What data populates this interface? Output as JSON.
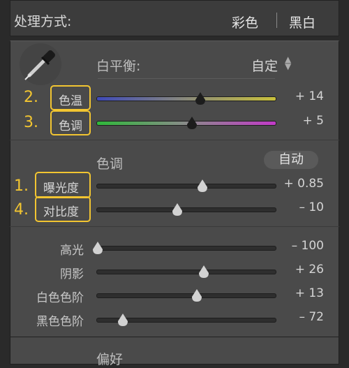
{
  "header": {
    "title": "处理方式:",
    "mode_color": "彩色",
    "mode_bw": "黑白"
  },
  "white_balance": {
    "label": "白平衡:",
    "preset": "自定",
    "temp": {
      "num": "2.",
      "label": "色温",
      "value": "+ 14",
      "level": 0.58
    },
    "tint": {
      "num": "3.",
      "label": "色调",
      "value": "+ 5",
      "level": 0.53
    }
  },
  "tone": {
    "title": "色调",
    "auto_label": "自动",
    "exposure": {
      "num": "1.",
      "label": "曝光度",
      "value": "+ 0.85",
      "level": 0.59
    },
    "contrast": {
      "num": "4.",
      "label": "对比度",
      "value": "– 10",
      "level": 0.45
    }
  },
  "presence": {
    "highlights": {
      "label": "高光",
      "value": "– 100",
      "level": 0.0
    },
    "shadows": {
      "label": "阴影",
      "value": "+ 26",
      "level": 0.6
    },
    "whites": {
      "label": "白色色阶",
      "value": "+ 13",
      "level": 0.56
    },
    "blacks": {
      "label": "黑色色阶",
      "value": "– 72",
      "level": 0.14
    }
  },
  "footer": {
    "title": "偏好"
  },
  "colors": {
    "highlight": "#f2c531",
    "panel": "#4a4a4a"
  }
}
